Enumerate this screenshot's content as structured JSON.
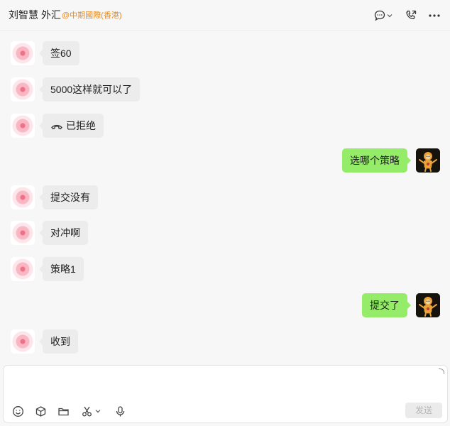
{
  "header": {
    "contact_name": "刘智慧 外汇",
    "org": "@中期國際(香港)"
  },
  "messages": [
    {
      "side": "in",
      "text": "签60"
    },
    {
      "side": "in",
      "text": "5000这样就可以了"
    },
    {
      "side": "in",
      "type": "call",
      "icon": "phone-hangup-icon",
      "text": "已拒绝"
    },
    {
      "side": "out",
      "text": "选哪个策略"
    },
    {
      "side": "in",
      "text": "提交没有"
    },
    {
      "side": "in",
      "text": "对冲啊"
    },
    {
      "side": "in",
      "text": "策略1"
    },
    {
      "side": "out",
      "text": "提交了"
    },
    {
      "side": "in",
      "text": "收到"
    }
  ],
  "composer": {
    "input_value": "",
    "send_label": "发送",
    "tools": [
      "emoji-icon",
      "sticker-cube-icon",
      "folder-icon",
      "scissors-icon",
      "chevron-down-icon",
      "microphone-icon"
    ]
  },
  "colors": {
    "accent_org": "#e58a1f",
    "outgoing_bubble": "#95ec69",
    "incoming_bubble": "#ececec"
  }
}
